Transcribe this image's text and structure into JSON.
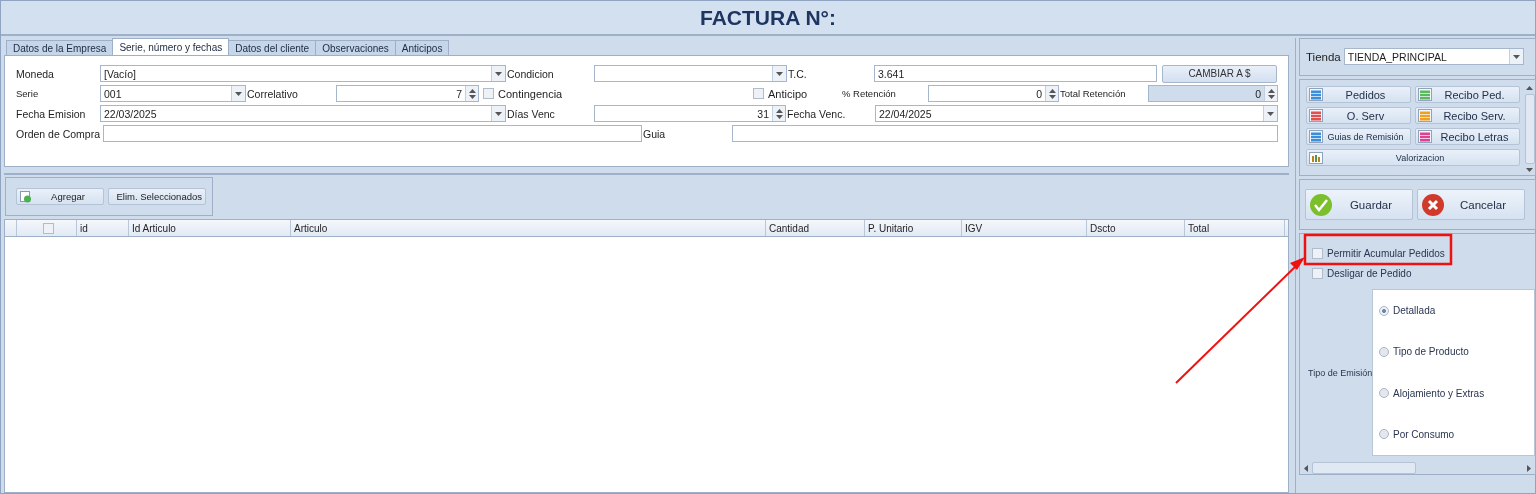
{
  "title": "FACTURA N°:",
  "tabs": [
    {
      "label": "Datos de la Empresa",
      "selected": false
    },
    {
      "label": "Serie, número y fechas",
      "selected": true
    },
    {
      "label": "Datos del cliente",
      "selected": false
    },
    {
      "label": "Observaciones",
      "selected": false
    },
    {
      "label": "Anticipos",
      "selected": false
    }
  ],
  "form": {
    "lines": [
      {
        "items": [
          {
            "kind": "label",
            "text": "Moneda"
          },
          {
            "kind": "combo",
            "value": "[Vacío]"
          },
          {
            "kind": "label",
            "text": "Condicion"
          },
          {
            "kind": "combo"
          },
          {
            "kind": "label",
            "text": "T.C."
          },
          {
            "kind": "input",
            "value": "3.641"
          },
          {
            "kind": "button",
            "text": "CAMBIAR A $"
          }
        ]
      },
      {
        "items": [
          {
            "kind": "small",
            "text": "Serie"
          },
          {
            "kind": "combo",
            "value": "001"
          },
          {
            "kind": "label",
            "text": "Correlativo"
          },
          {
            "kind": "spin",
            "value": "7",
            "disabled": false
          },
          {
            "kind": "check",
            "text": "Contingencia",
            "checked": false
          },
          {
            "kind": "check",
            "text": "Anticipo",
            "checked": false
          },
          {
            "kind": "small",
            "text": "% Retención"
          },
          {
            "kind": "spin",
            "value": "0",
            "disabled": false
          },
          {
            "kind": "small",
            "text": "Total Retención"
          },
          {
            "kind": "spin",
            "value": "0",
            "disabled": true
          }
        ]
      },
      {
        "items": [
          {
            "kind": "label",
            "text": "Fecha Emision"
          },
          {
            "kind": "combo",
            "value": "22/03/2025"
          },
          {
            "kind": "label",
            "text": "Días Venc"
          },
          {
            "kind": "spin",
            "value": "31",
            "disabled": false
          },
          {
            "kind": "label",
            "text": "Fecha Venc."
          },
          {
            "kind": "combo",
            "value": "22/04/2025"
          }
        ]
      },
      {
        "items": [
          {
            "kind": "label",
            "text": "Orden de Compra"
          },
          {
            "kind": "input"
          },
          {
            "kind": "label",
            "text": "Guia"
          },
          {
            "kind": "input"
          }
        ]
      }
    ]
  },
  "toolbar": [
    {
      "kind": "add",
      "label": "Agregar"
    },
    {
      "kind": "delete",
      "label": "Elim. Seleccionados"
    }
  ],
  "table": {
    "select_all_checked": false,
    "columns": [
      "id",
      "Id Articulo",
      "Articulo",
      "Cantidad",
      "P. Unitario",
      "IGV",
      "Dscto",
      "Total"
    ]
  },
  "store": {
    "label": "Tienda",
    "value": "TIENDA_PRINCIPAL"
  },
  "shortcuts": [
    {
      "label": "Pedidos",
      "color": "#3a8fdc",
      "small": false
    },
    {
      "label": "Recibo Ped.",
      "color": "#5cb85c",
      "small": false
    },
    {
      "label": "O. Serv",
      "color": "#e05050",
      "small": false
    },
    {
      "label": "Recibo Serv.",
      "color": "#f0a020",
      "small": false
    },
    {
      "label": "Guias de Remisión",
      "color": "#3a8fdc",
      "small": true
    },
    {
      "label": "Recibo Letras",
      "color": "#e04090",
      "small": false
    }
  ],
  "valuation": {
    "label": "Valorizacion"
  },
  "actions": [
    {
      "kind": "save",
      "label": "Guardar"
    },
    {
      "kind": "cancel",
      "label": "Cancelar"
    }
  ],
  "options": [
    {
      "label": "Permitir Acumular Pedidos",
      "checked": false
    },
    {
      "label": "Desligar de Pedido",
      "checked": false
    }
  ],
  "emission": {
    "label": "Tipo de Emisión",
    "choices": [
      {
        "label": "Detallada",
        "selected": true
      },
      {
        "label": "Tipo de Producto",
        "selected": false
      },
      {
        "label": "Alojamiento y Extras",
        "selected": false
      },
      {
        "label": "Por Consumo",
        "selected": false
      }
    ]
  }
}
